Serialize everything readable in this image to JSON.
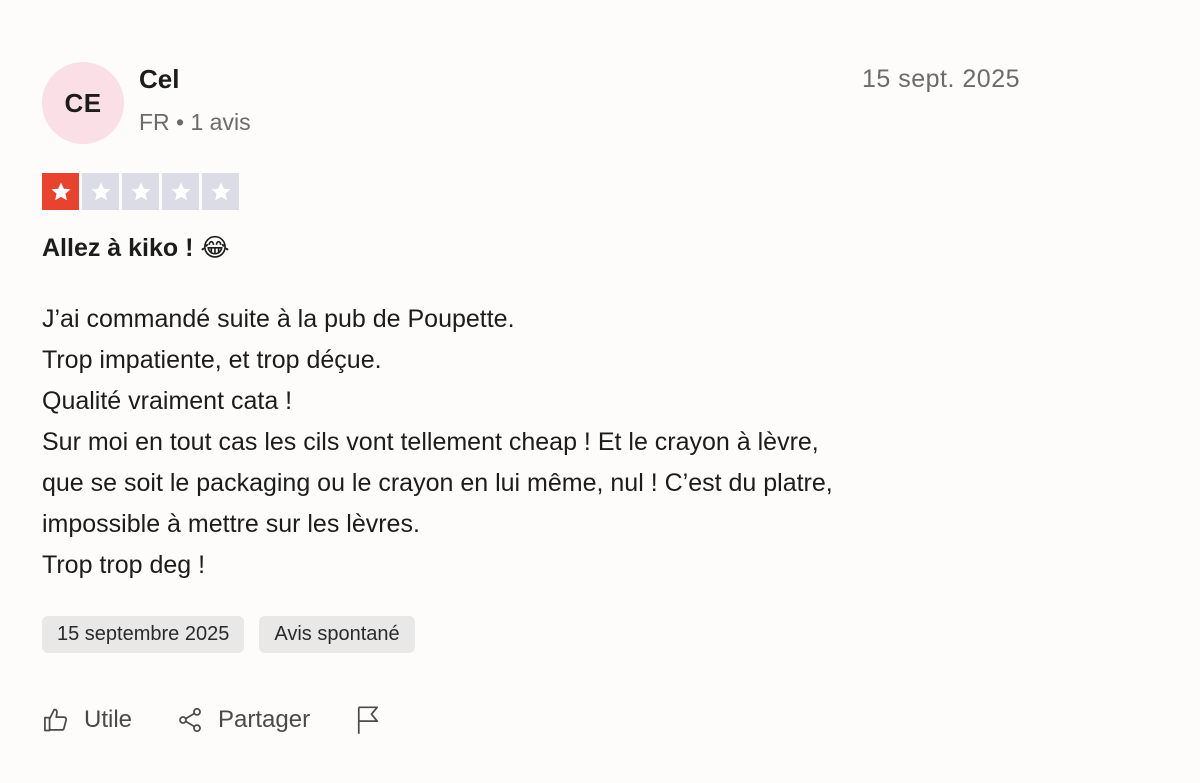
{
  "reviewer": {
    "initials": "CE",
    "name": "Cel",
    "meta": "FR • 1 avis"
  },
  "review": {
    "date": "15 sept. 2025",
    "rating": 1,
    "max_rating": 5,
    "title": "Allez à kiko ! 😂",
    "body_lines": [
      "J’ai commandé suite à la pub de Poupette.",
      "Trop impatiente, et trop déçue.",
      "Qualité vraiment cata !",
      "Sur moi en tout cas les cils vont tellement cheap ! Et le crayon à lèvre,",
      "que se soit le packaging ou le crayon en lui même, nul ! C’est du platre,",
      "impossible à mettre sur les lèvres.",
      "Trop trop deg !"
    ],
    "tags": [
      "15 septembre 2025",
      "Avis spontané"
    ]
  },
  "actions": {
    "useful_label": "Utile",
    "share_label": "Partager",
    "useful_icon": "thumbs-up-icon",
    "share_icon": "share-icon",
    "report_icon": "flag-icon"
  },
  "colors": {
    "star_filled": "#e8432e",
    "star_empty": "#dcdce6",
    "avatar_bg": "#fbdfe6"
  }
}
